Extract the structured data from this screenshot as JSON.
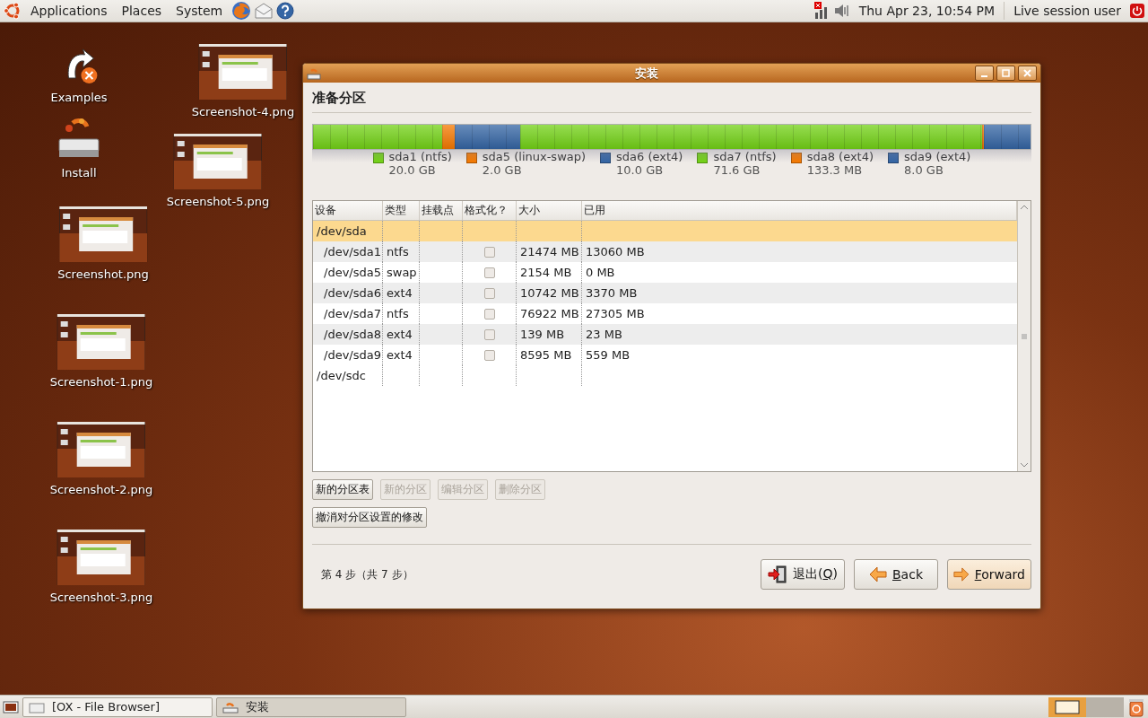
{
  "top_panel": {
    "menus": [
      {
        "label": "Applications"
      },
      {
        "label": "Places"
      },
      {
        "label": "System"
      }
    ],
    "clock": "Thu Apr 23, 10:54 PM",
    "user": "Live session user"
  },
  "desktop_icons": [
    {
      "label": "Examples",
      "kind": "examples"
    },
    {
      "label": "Install",
      "kind": "install"
    },
    {
      "label": "Screenshot.png",
      "kind": "thumbnail"
    },
    {
      "label": "Screenshot-1.png",
      "kind": "thumbnail"
    },
    {
      "label": "Screenshot-2.png",
      "kind": "thumbnail"
    },
    {
      "label": "Screenshot-3.png",
      "kind": "thumbnail"
    },
    {
      "label": "Screenshot-4.png",
      "kind": "thumbnail"
    },
    {
      "label": "Screenshot-5.png",
      "kind": "thumbnail"
    }
  ],
  "window": {
    "title": "安装",
    "heading": "准备分区",
    "partitions": [
      {
        "name": "sda1 (ntfs)",
        "size": "20.0 GB",
        "color": "#73d216"
      },
      {
        "name": "sda5 (linux-swap)",
        "size": "2.0 GB",
        "color": "#f57900"
      },
      {
        "name": "sda6 (ext4)",
        "size": "10.0 GB",
        "color": "#3465a4"
      },
      {
        "name": "sda7 (ntfs)",
        "size": "71.6 GB",
        "color": "#73d216"
      },
      {
        "name": "sda8 (ext4)",
        "size": "133.3 MB",
        "color": "#f57900"
      },
      {
        "name": "sda9 (ext4)",
        "size": "8.0 GB",
        "color": "#3465a4"
      }
    ],
    "table": {
      "columns": [
        "设备",
        "类型",
        "挂载点",
        "格式化？",
        "大小",
        "已用"
      ],
      "rows": [
        {
          "kind": "disk",
          "device": "/dev/sda",
          "selected": true
        },
        {
          "kind": "partition",
          "device": "/dev/sda1",
          "type": "ntfs",
          "format": false,
          "size": "21474 MB",
          "used": "13060 MB",
          "selected": false
        },
        {
          "kind": "partition",
          "device": "/dev/sda5",
          "type": "swap",
          "format": false,
          "size": "2154 MB",
          "used": "0 MB",
          "selected": false
        },
        {
          "kind": "partition",
          "device": "/dev/sda6",
          "type": "ext4",
          "format": false,
          "size": "10742 MB",
          "used": "3370 MB",
          "selected": false
        },
        {
          "kind": "partition",
          "device": "/dev/sda7",
          "type": "ntfs",
          "format": false,
          "size": "76922 MB",
          "used": "27305 MB",
          "selected": false
        },
        {
          "kind": "partition",
          "device": "/dev/sda8",
          "type": "ext4",
          "format": false,
          "size": "139 MB",
          "used": "23 MB",
          "selected": false
        },
        {
          "kind": "partition",
          "device": "/dev/sda9",
          "type": "ext4",
          "format": false,
          "size": "8595 MB",
          "used": "559 MB",
          "selected": false
        },
        {
          "kind": "disk",
          "device": "/dev/sdc",
          "selected": false
        }
      ]
    },
    "table_buttons": [
      {
        "label": "新的分区表",
        "disabled": false
      },
      {
        "label": "新的分区",
        "disabled": true
      },
      {
        "label": "编辑分区",
        "disabled": true
      },
      {
        "label": "删除分区",
        "disabled": true
      }
    ],
    "revert_button": {
      "label": "撤消对分区设置的修改",
      "disabled": false
    },
    "step": "第 4 步（共 7 步）",
    "nav_buttons": [
      {
        "kind": "quit",
        "before": "退出(",
        "key": "Q",
        "after": ")"
      },
      {
        "kind": "back",
        "key": "B",
        "after": "ack"
      },
      {
        "kind": "forward",
        "key": "F",
        "after": "orward"
      }
    ]
  },
  "taskbar": [
    {
      "label": "[OX - File Browser]",
      "kind": "files",
      "selected": false
    },
    {
      "label": "安装",
      "kind": "installer",
      "selected": true
    }
  ]
}
